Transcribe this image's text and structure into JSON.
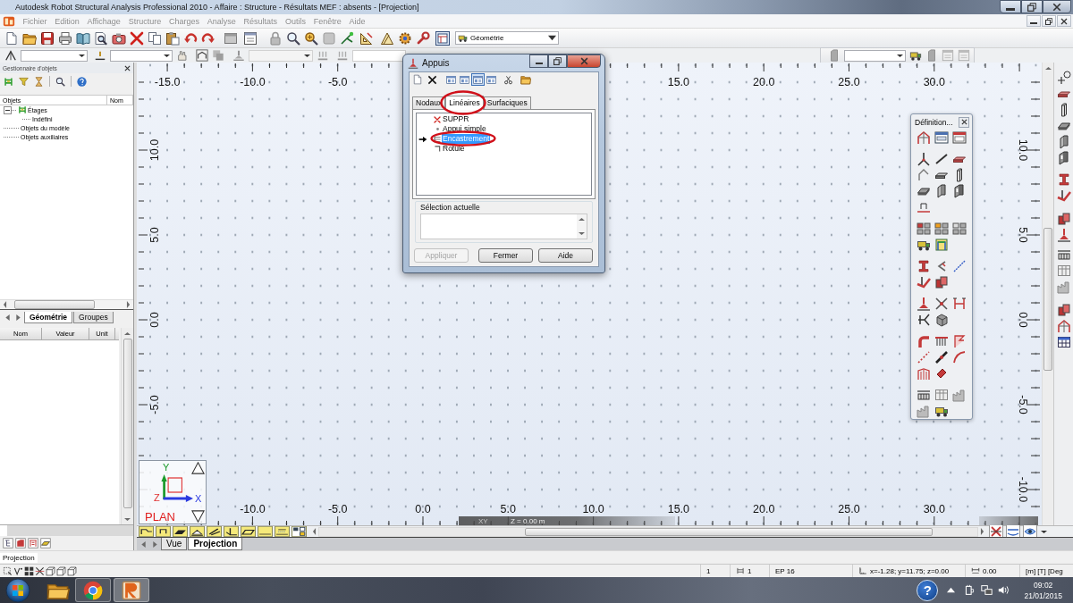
{
  "window": {
    "title": "Autodesk Robot Structural Analysis Professional 2010 - Affaire : Structure - Résultats MEF : absents - [Projection]"
  },
  "menu": [
    {
      "label": "Fichier",
      "disabled": true
    },
    {
      "label": "Edition",
      "disabled": true
    },
    {
      "label": "Affichage",
      "disabled": true
    },
    {
      "label": "Structure",
      "disabled": true
    },
    {
      "label": "Charges",
      "disabled": true
    },
    {
      "label": "Analyse",
      "disabled": true
    },
    {
      "label": "Résultats",
      "disabled": true
    },
    {
      "label": "Outils",
      "disabled": true
    },
    {
      "label": "Fenêtre",
      "disabled": true
    },
    {
      "label": "Aide",
      "disabled": true
    }
  ],
  "toolbar": {
    "layout": "Géométrie"
  },
  "object_manager": {
    "title": "Gestionnaire d'objets",
    "columns": [
      "Objets",
      "Nom"
    ],
    "tree": [
      {
        "label": "Étages",
        "expanded": true,
        "children": [
          {
            "label": "Indéfini"
          }
        ]
      },
      {
        "label": "Objets du modèle"
      },
      {
        "label": "Objets auxiliaires"
      }
    ],
    "tabs": [
      {
        "label": "Géométrie",
        "selected": true
      },
      {
        "label": "Groupes",
        "selected": false
      }
    ],
    "property_columns": [
      "Nom",
      "Valeur",
      "Unit"
    ]
  },
  "view": {
    "top_ruler": [
      "-15.0",
      "-10.0",
      "-5.0",
      "15.0",
      "20.0",
      "25.0",
      "30.0"
    ],
    "bottom_ruler": [
      "-10.0",
      "-5.0",
      "0.0",
      "5.0",
      "10.0",
      "15.0",
      "20.0",
      "25.0",
      "30.0"
    ],
    "left_ruler": [
      "10.0",
      "5.0",
      "0.0",
      "-5.0"
    ],
    "right_ruler": [
      "10.0",
      "5.0",
      "0.0",
      "-5.0",
      "-10.0"
    ],
    "axes": {
      "y": "Y",
      "x": "X",
      "z": "Z",
      "plane": "PLAN"
    },
    "plane_label": "XY",
    "elevation_label": "Z = 0.00 m",
    "tabs": [
      {
        "label": "Vue",
        "selected": false
      },
      {
        "label": "Projection",
        "selected": true
      }
    ]
  },
  "supports_dialog": {
    "title": "Appuis",
    "view_buttons": [
      {
        "selected": false
      },
      {
        "selected": false
      },
      {
        "selected": true
      },
      {
        "selected": false
      }
    ],
    "tabs": [
      {
        "label": "Nodaux",
        "selected": false
      },
      {
        "label": "Linéaires",
        "selected": true
      },
      {
        "label": "Surfaciques",
        "selected": false
      }
    ],
    "items": [
      {
        "label": "SUPPR",
        "kind": "delete",
        "selected": false
      },
      {
        "label": "Appui simple",
        "kind": "pinned",
        "selected": false
      },
      {
        "label": "Encastrement",
        "kind": "fixed",
        "selected": true
      },
      {
        "label": "Rotule",
        "kind": "hinge",
        "selected": false
      }
    ],
    "selection_label": "Sélection actuelle",
    "buttons": [
      {
        "label": "Appliquer",
        "disabled": true
      },
      {
        "label": "Fermer",
        "disabled": false
      },
      {
        "label": "Aide",
        "disabled": false
      }
    ]
  },
  "definition_palette": {
    "title": "Définition..."
  },
  "status_line": "Projection",
  "status_bar": [
    "1",
    "1",
    "EP 16",
    "x=-1.28; y=11.75; z=0.00",
    "0.00",
    "[m] [T] [Deg"
  ],
  "taskbar": {
    "help": "?",
    "time": "09:02",
    "date": "21/01/2015"
  }
}
